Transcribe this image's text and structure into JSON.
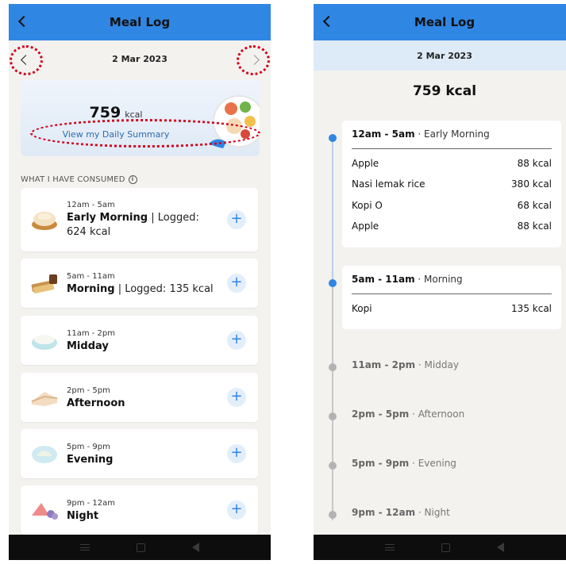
{
  "left": {
    "title": "Meal Log",
    "date": "2 Mar 2023",
    "summary": {
      "kcal_value": "759",
      "kcal_unit": "kcal",
      "link": "View my Daily Summary"
    },
    "section_label": "WHAT I HAVE CONSUMED",
    "meals": [
      {
        "time": "12am - 5am",
        "name": "Early Morning",
        "logged": "| Logged: 624 kcal",
        "icon": "dimsum-icon"
      },
      {
        "time": "5am - 11am",
        "name": "Morning",
        "logged": "| Logged: 135 kcal",
        "icon": "kaya-toast-icon"
      },
      {
        "time": "11am - 2pm",
        "name": "Midday",
        "logged": "",
        "icon": "rice-bowl-icon"
      },
      {
        "time": "2pm - 5pm",
        "name": "Afternoon",
        "logged": "",
        "icon": "kueh-icon"
      },
      {
        "time": "5pm - 9pm",
        "name": "Evening",
        "logged": "",
        "icon": "dumpling-icon"
      },
      {
        "time": "9pm - 12am",
        "name": "Night",
        "logged": "",
        "icon": "fruit-icon"
      }
    ]
  },
  "right": {
    "title": "Meal Log",
    "date": "2 Mar 2023",
    "total": "759 kcal",
    "logged_slots": [
      {
        "time": "12am - 5am",
        "label": "· Early Morning",
        "items": [
          {
            "name": "Apple",
            "kcal": "88 kcal"
          },
          {
            "name": "Nasi lemak rice",
            "kcal": "380 kcal"
          },
          {
            "name": "Kopi O",
            "kcal": "68 kcal"
          },
          {
            "name": "Apple",
            "kcal": "88 kcal"
          }
        ]
      },
      {
        "time": "5am - 11am",
        "label": "· Morning",
        "items": [
          {
            "name": "Kopi",
            "kcal": "135 kcal"
          }
        ]
      }
    ],
    "empty_slots": [
      {
        "time": "11am - 2pm",
        "label": "· Midday"
      },
      {
        "time": "2pm - 5pm",
        "label": "· Afternoon"
      },
      {
        "time": "5pm - 9pm",
        "label": "· Evening"
      },
      {
        "time": "9pm - 12am",
        "label": "· Night"
      }
    ]
  },
  "colors": {
    "app_bar": "#2f86e3",
    "highlight_ring": "#d0021b",
    "timeline_active": "#2f86e3"
  }
}
